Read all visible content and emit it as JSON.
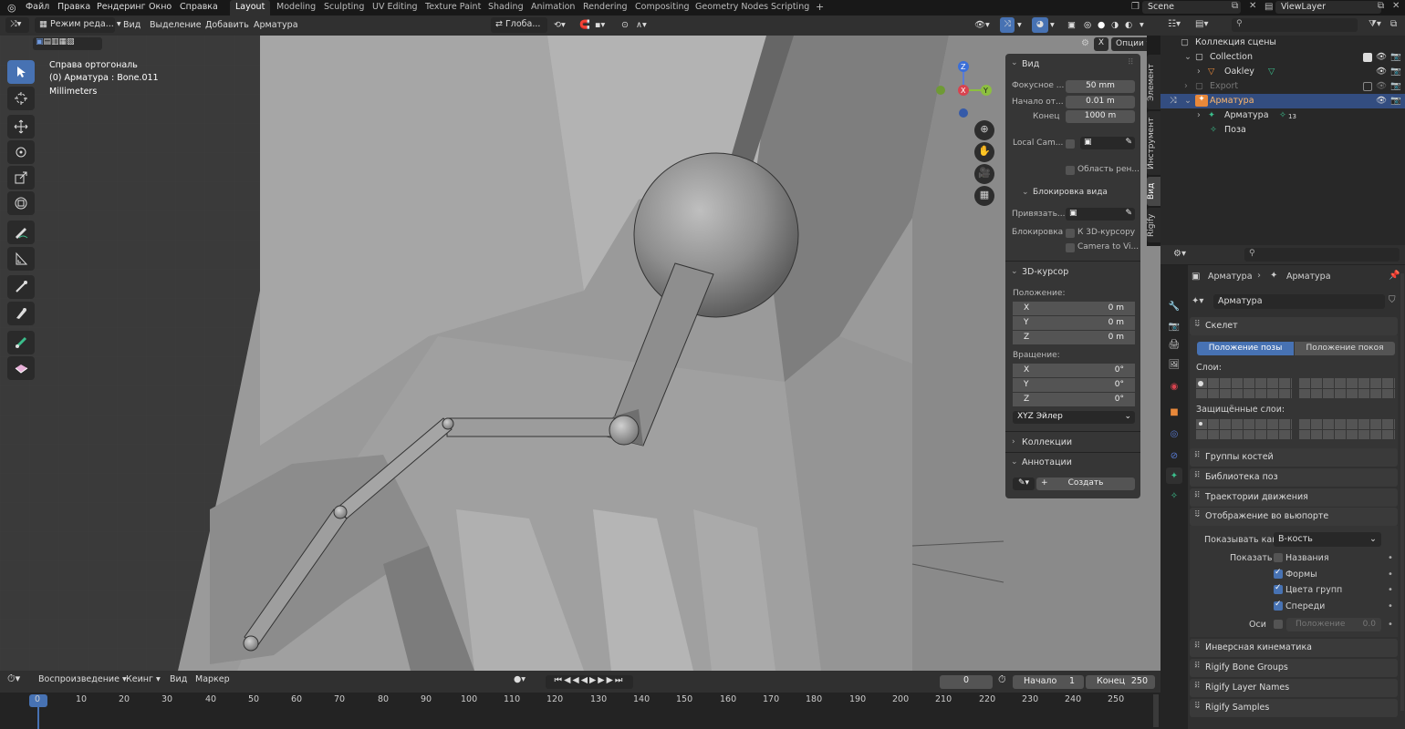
{
  "menu": [
    "Файл",
    "Правка",
    "Рендеринг",
    "Окно",
    "Справка"
  ],
  "workspaces": [
    "Layout",
    "Modeling",
    "Sculpting",
    "UV Editing",
    "Texture Paint",
    "Shading",
    "Animation",
    "Rendering",
    "Compositing",
    "Geometry Nodes",
    "Scripting"
  ],
  "active_workspace": "Layout",
  "scene": "Scene",
  "view_layer": "ViewLayer",
  "viewport_header": {
    "mode": "Режим реда...",
    "view": "Вид",
    "select": "Выделение",
    "add": "Добавить",
    "armature": "Арматура",
    "transform": "Глоба...",
    "options": "Опции"
  },
  "overlay": {
    "line1": "Справа ортогональ",
    "line2": "(0) Арматура : Bone.011",
    "line3": "Millimeters"
  },
  "gizmo": {
    "z": "Z",
    "y": "Y",
    "x": "X"
  },
  "npanel": {
    "view_title": "Вид",
    "focal_label": "Фокусное ...",
    "focal_value": "50 mm",
    "clip_start_label": "Начало от...",
    "clip_start_value": "0.01 m",
    "clip_end_label": "Конец",
    "clip_end_value": "1000 m",
    "local_cam_label": "Local Cam...",
    "render_region_label": "Область рен...",
    "lock_view_title": "Блокировка вида",
    "lock_to_label": "Привязать...",
    "lock_label": "Блокировка",
    "lock_3d_cursor": "К 3D-курсору",
    "camera_to_view": "Camera to Vi...",
    "cursor_title": "3D-курсор",
    "location_label": "Положение:",
    "loc_x": "0 m",
    "loc_y": "0 m",
    "loc_z": "0 m",
    "rotation_label": "Вращение:",
    "rot_x": "0°",
    "rot_y": "0°",
    "rot_z": "0°",
    "rotation_mode": "XYZ Эйлер",
    "collections_title": "Коллекции",
    "annotations_title": "Аннотации",
    "create_button": "Создать"
  },
  "sidebar_tabs": [
    "Элемент",
    "Инструмент",
    "Вид",
    "Rigify"
  ],
  "active_sidebar_tab": "Вид",
  "timeline": {
    "playback": "Воспроизведение",
    "keying": "Кеинг",
    "view": "Вид",
    "marker": "Маркер",
    "current_frame": "0",
    "start_label": "Начало",
    "start_value": "1",
    "end_label": "Конец",
    "end_value": "250",
    "ticks": [
      "0",
      "10",
      "20",
      "30",
      "40",
      "50",
      "60",
      "70",
      "80",
      "90",
      "100",
      "110",
      "120",
      "130",
      "140",
      "150",
      "160",
      "170",
      "180",
      "190",
      "200",
      "210",
      "220",
      "230",
      "240",
      "250"
    ]
  },
  "outliner": {
    "rows": [
      {
        "label": "Коллекция сцены"
      },
      {
        "label": "Collection"
      },
      {
        "label": "Oakley"
      },
      {
        "label": "Export"
      },
      {
        "label": "Арматура"
      },
      {
        "label": "Арматура",
        "badge": "13"
      },
      {
        "label": "Поза"
      }
    ]
  },
  "properties": {
    "breadcrumb_a": "Арматура",
    "breadcrumb_b": "Арматура",
    "data_name": "Арматура",
    "skeleton_title": "Скелет",
    "pose_position": "Положение позы",
    "rest_position": "Положение покоя",
    "layers_label": "Слои:",
    "protected_layers_label": "Защищённые слои:",
    "sections": [
      "Группы костей",
      "Библиотека поз",
      "Траектории движения"
    ],
    "viewport_display_title": "Отображение во вьюпорте",
    "display_as_label": "Показывать как",
    "display_as_value": "В-кость",
    "show_label": "Показать",
    "show_names": "Названия",
    "show_shapes": "Формы",
    "show_group_colors": "Цвета групп",
    "show_in_front": "Спереди",
    "axes_label": "Оси",
    "axes_position": "Положение",
    "axes_value": "0.0",
    "bottom_sections": [
      "Инверсная кинематика",
      "Rigify Bone Groups",
      "Rigify Layer Names",
      "Rigify Samples"
    ]
  },
  "colors": {
    "accent": "#4772b3",
    "selected_row": "#334d80",
    "bone_orange": "#e8883a",
    "armature_green": "#3bbd8b"
  }
}
